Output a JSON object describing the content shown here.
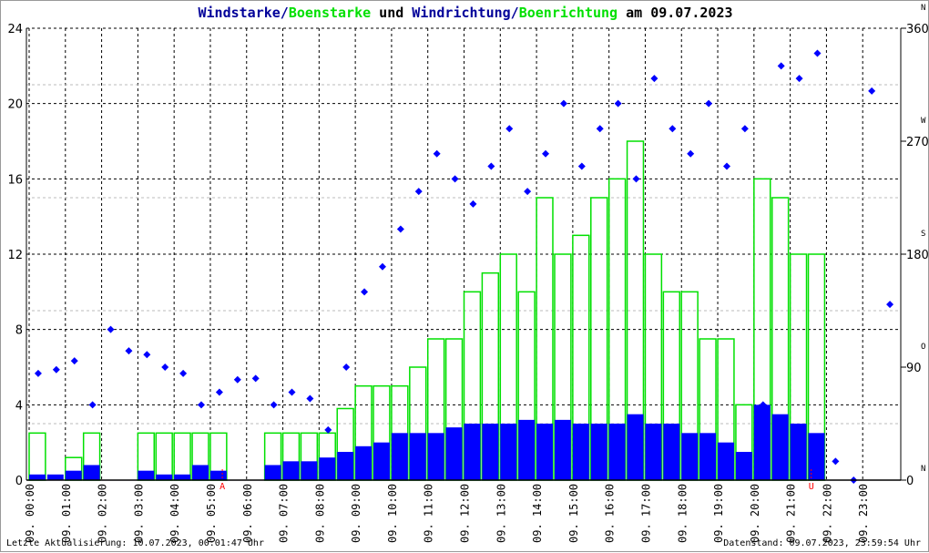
{
  "title": {
    "part1": "Windstarke",
    "sep1": "/",
    "part2": "Boenstarke",
    "part3": " und ",
    "part4": "Windrichtung",
    "sep2": "/",
    "part5": "Boenrichtung",
    "part6": " am 09.07.2023"
  },
  "footer": {
    "left": "Letzte Aktualisierung: 10.07.2023, 00:01:47 Uhr",
    "right": "Datenstand: 09.07.2023, 23:59:54 Uhr"
  },
  "colors": {
    "speed": "#0000ff",
    "gust": "#00e000",
    "title_blue": "#000099",
    "marker": "#ff0000"
  },
  "chart_data": {
    "type": "bar",
    "title": "Windstarke/Boenstarke und Windrichtung/Boenrichtung am 09.07.2023",
    "x_tick_labels": [
      "09. 00:00",
      "09. 01:00",
      "09. 02:00",
      "09. 03:00",
      "09. 04:00",
      "09. 05:00",
      "09. 06:00",
      "09. 07:00",
      "09. 08:00",
      "09. 09:00",
      "09. 10:00",
      "09. 11:00",
      "09. 12:00",
      "09. 13:00",
      "09. 14:00",
      "09. 15:00",
      "09. 16:00",
      "09. 17:00",
      "09. 18:00",
      "09. 19:00",
      "09. 20:00",
      "09. 21:00",
      "09. 22:00",
      "09. 23:00"
    ],
    "y_left": {
      "ticks": [
        0,
        4,
        8,
        12,
        16,
        20,
        24
      ],
      "ylim": [
        0,
        24
      ]
    },
    "y_right": {
      "ticks": [
        0,
        90,
        180,
        270,
        360
      ],
      "labels": [
        "N",
        "O",
        "S",
        "W",
        "N"
      ],
      "ylim": [
        0,
        360
      ]
    },
    "markers": [
      {
        "label": "A",
        "hour": 5.33
      },
      {
        "label": "U",
        "hour": 21.58
      }
    ],
    "x_hours_step": 0.5,
    "series": [
      {
        "name": "Windstarke",
        "kind": "bar",
        "values": [
          0.3,
          0.3,
          0.5,
          0.8,
          0,
          0,
          0.5,
          0.3,
          0.3,
          0.8,
          0.5,
          0,
          0,
          0.8,
          1,
          1,
          1.2,
          1.5,
          1.8,
          2,
          2.5,
          2.5,
          2.5,
          2.8,
          3,
          3,
          3,
          3.2,
          3,
          3.2,
          3,
          3,
          3,
          3.5,
          3,
          3,
          2.5,
          2.5,
          2,
          1.5,
          4,
          3.5,
          3,
          2.5,
          0,
          0,
          0,
          0
        ]
      },
      {
        "name": "Boenstarke",
        "kind": "bar",
        "values": [
          2.5,
          0,
          1.2,
          2.5,
          0,
          0,
          2.5,
          2.5,
          2.5,
          2.5,
          2.5,
          0,
          0,
          2.5,
          2.5,
          2.5,
          2.5,
          3.8,
          5,
          5,
          5,
          6,
          7.5,
          7.5,
          10,
          11,
          12,
          10,
          15,
          12,
          13,
          15,
          16,
          18,
          12,
          10,
          10,
          7.5,
          7.5,
          4,
          16,
          15,
          12,
          12,
          0,
          0,
          0,
          0
        ]
      },
      {
        "name": "Windrichtung",
        "kind": "scatter",
        "unit": "deg",
        "values": [
          85,
          88,
          95,
          60,
          120,
          103,
          100,
          90,
          85,
          60,
          70,
          80,
          81,
          60,
          70,
          65,
          40,
          90,
          150,
          170,
          200,
          230,
          260,
          240,
          220,
          250,
          280,
          230,
          260,
          300,
          250,
          280,
          300,
          240,
          320,
          280,
          260,
          300,
          250,
          280,
          60,
          330,
          320,
          340,
          15,
          0,
          310,
          140
        ]
      }
    ]
  }
}
